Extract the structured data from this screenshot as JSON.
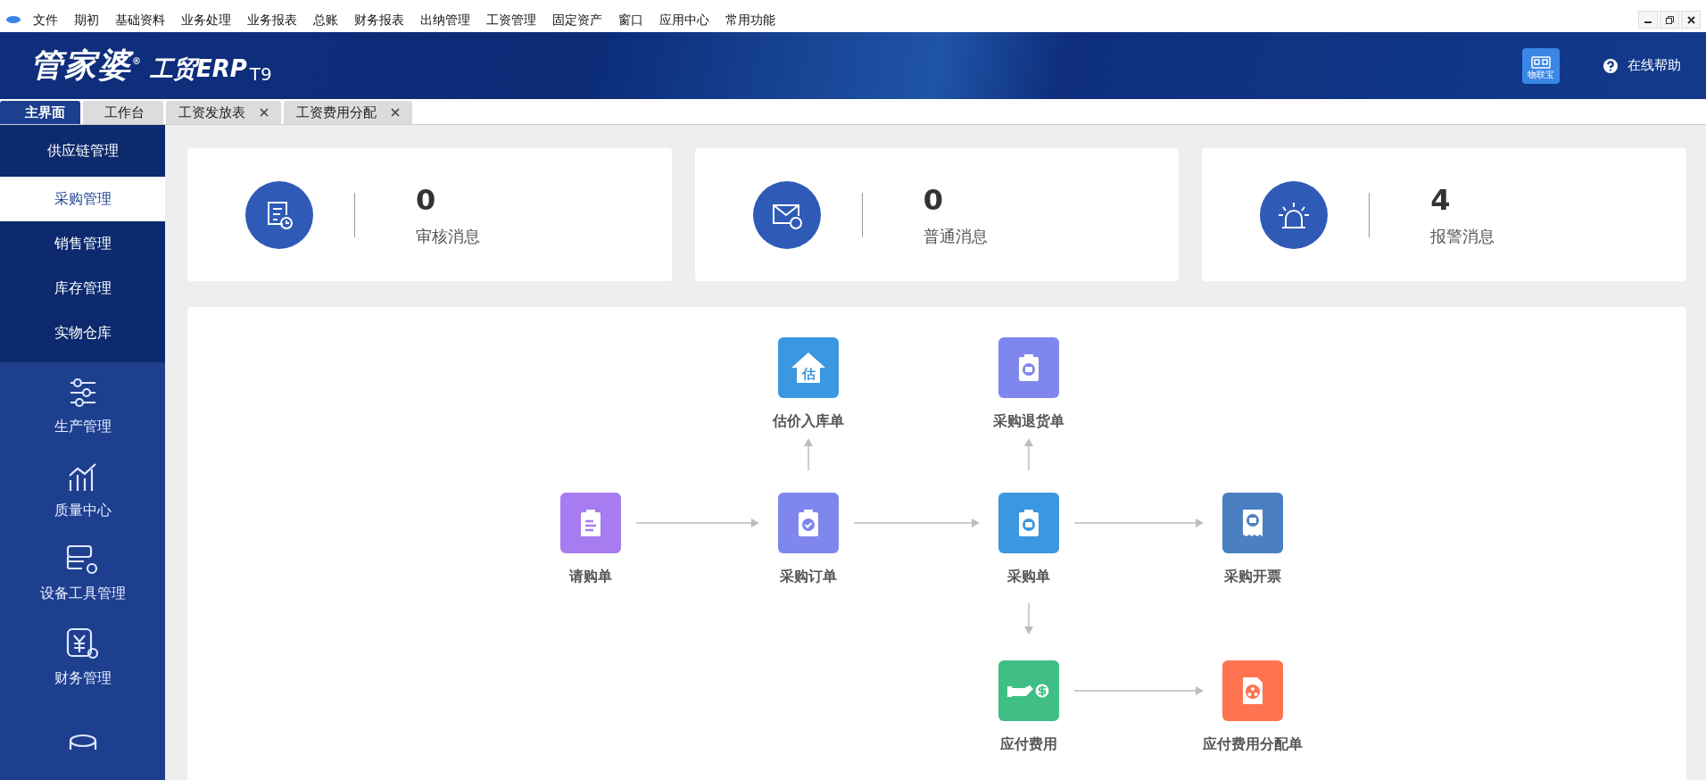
{
  "menu_bar": {
    "items": [
      "文件",
      "期初",
      "基础资料",
      "业务处理",
      "业务报表",
      "总账",
      "财务报表",
      "出纳管理",
      "工资管理",
      "固定资产",
      "窗口",
      "应用中心",
      "常用功能"
    ]
  },
  "header": {
    "logo_main": "管家婆$^{®}$",
    "logo_sub": "工贸ERP",
    "logo_version": "T9",
    "badge": "物联宝",
    "help": "在线帮助"
  },
  "tabs": [
    {
      "label": "主界面",
      "selected": true,
      "closable": false
    },
    {
      "label": "工作台",
      "selected": false,
      "closable": false
    },
    {
      "label": "工资发放表",
      "selected": false,
      "closable": true
    },
    {
      "label": "工资费用分配",
      "selected": false,
      "closable": true
    }
  ],
  "sidebar": {
    "header": "供应链管理",
    "sub_items": [
      {
        "label": "采购管理",
        "selected": true
      },
      {
        "label": "销售管理",
        "selected": false
      },
      {
        "label": "库存管理",
        "selected": false
      },
      {
        "label": "实物仓库",
        "selected": false
      }
    ],
    "modules": [
      {
        "label": "生产管理",
        "kind": "sliders"
      },
      {
        "label": "质量中心",
        "kind": "chart"
      },
      {
        "label": "设备工具管理",
        "kind": "server"
      },
      {
        "label": "财务管理",
        "kind": "finance"
      },
      {
        "kind": "database"
      }
    ]
  },
  "message_cards": [
    {
      "count": "0",
      "label": "审核消息",
      "kind": "audit"
    },
    {
      "count": "0",
      "label": "普通消息",
      "kind": "mail"
    },
    {
      "count": "4",
      "label": "报警消息",
      "kind": "alarm"
    }
  ],
  "flow": {
    "nodes": [
      {
        "label": "请购单",
        "kind": "list",
        "color": "#a67cf0"
      },
      {
        "label": "采购订单",
        "kind": "check",
        "color": "#7f86ee"
      },
      {
        "label": "采购单",
        "kind": "box",
        "color": "#3a97e0"
      },
      {
        "label": "采购开票",
        "kind": "receipt",
        "color": "#4a7fc1"
      },
      {
        "label": "估价入库单",
        "kind": "house",
        "glyph": "估",
        "color": "#3a97e0"
      },
      {
        "label": "采购退货单",
        "kind": "box",
        "color": "#7f86ee"
      },
      {
        "label": "应付费用",
        "kind": "cash",
        "color": "#3fbf85"
      },
      {
        "label": "应付费用分配单",
        "kind": "share",
        "color": "#ff7350"
      }
    ]
  }
}
